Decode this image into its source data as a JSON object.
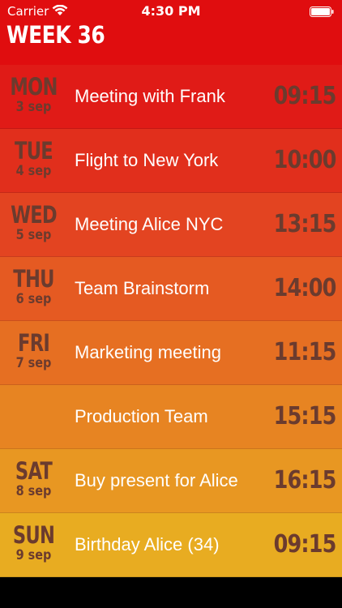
{
  "status_bar": {
    "carrier": "Carrier",
    "time": "4:30 PM"
  },
  "header": {
    "title": "WEEK 36",
    "color": "#e00d0f"
  },
  "events": [
    {
      "day": "MON",
      "date": "3 sep",
      "title": "Meeting with Frank",
      "time": "09:15",
      "color": "#e01b17"
    },
    {
      "day": "TUE",
      "date": "4 sep",
      "title": "Flight to New York",
      "time": "10:00",
      "color": "#e12f1c"
    },
    {
      "day": "WED",
      "date": "5 sep",
      "title": "Meeting Alice NYC",
      "time": "13:15",
      "color": "#e34421"
    },
    {
      "day": "THU",
      "date": "6 sep",
      "title": "Team Brainstorm",
      "time": "14:00",
      "color": "#e55a22"
    },
    {
      "day": "FRI",
      "date": "7 sep",
      "title": "Marketing meeting",
      "time": "11:15",
      "color": "#e66f22"
    },
    {
      "day": "",
      "date": "",
      "title": "Production Team",
      "time": "15:15",
      "color": "#e78422"
    },
    {
      "day": "SAT",
      "date": "8 sep",
      "title": "Buy present for Alice",
      "time": "16:15",
      "color": "#e89722"
    },
    {
      "day": "SUN",
      "date": "9 sep",
      "title": "Birthday Alice (34)",
      "time": "09:15",
      "color": "#e8ac21"
    }
  ]
}
